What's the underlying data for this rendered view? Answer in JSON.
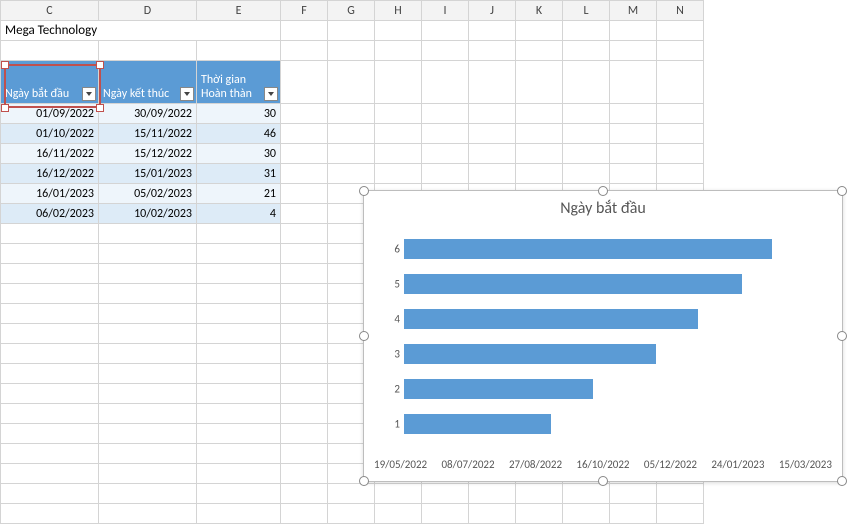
{
  "columns": [
    "C",
    "D",
    "E",
    "F",
    "G",
    "H",
    "I",
    "J",
    "K",
    "L",
    "M",
    "N"
  ],
  "title": "Mega Technology",
  "headers": {
    "c": "Ngày bắt đầu",
    "d": "Ngày kết thúc",
    "e1": "Thời gian",
    "e2": "Hoàn thàn"
  },
  "rows": [
    {
      "c": "01/09/2022",
      "d": "30/09/2022",
      "e": "30"
    },
    {
      "c": "01/10/2022",
      "d": "15/11/2022",
      "e": "46"
    },
    {
      "c": "16/11/2022",
      "d": "15/12/2022",
      "e": "30"
    },
    {
      "c": "16/12/2022",
      "d": "15/01/2023",
      "e": "31"
    },
    {
      "c": "16/01/2023",
      "d": "05/02/2023",
      "e": "21"
    },
    {
      "c": "06/02/2023",
      "d": "10/02/2023",
      "e": "4"
    }
  ],
  "chart_data": {
    "type": "bar",
    "orientation": "horizontal",
    "title": "Ngày bắt đầu",
    "categories": [
      "1",
      "2",
      "3",
      "4",
      "5",
      "6"
    ],
    "x_ticks": [
      "19/05/2022",
      "08/07/2022",
      "27/08/2022",
      "16/10/2022",
      "05/12/2022",
      "24/01/2023",
      "15/03/2023"
    ],
    "series": [
      {
        "name": "Ngày bắt đầu",
        "values_date": [
          "01/09/2022",
          "01/10/2022",
          "16/11/2022",
          "16/12/2022",
          "16/01/2023",
          "06/02/2023"
        ]
      }
    ],
    "bar_fractions": [
      0.35,
      0.45,
      0.6,
      0.7,
      0.805,
      0.875
    ]
  }
}
